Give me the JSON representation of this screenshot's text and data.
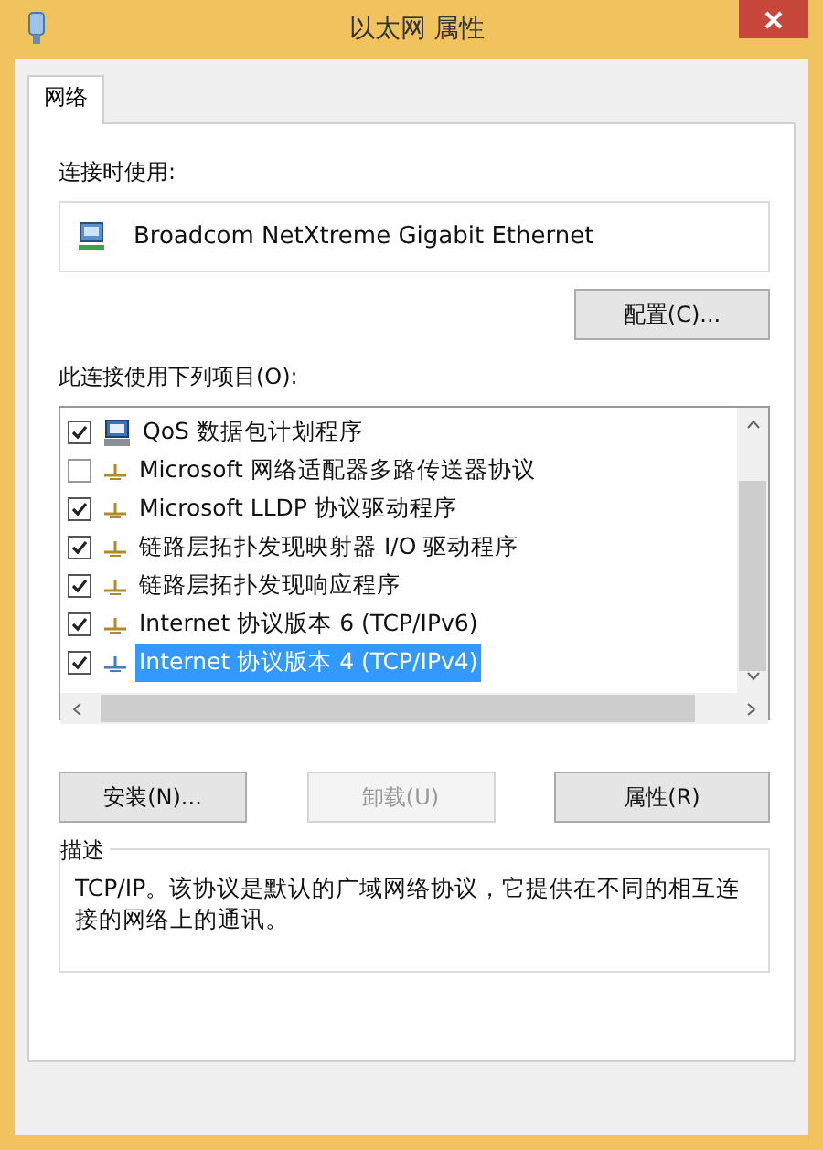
{
  "window": {
    "title": "以太网 属性"
  },
  "tabs": [
    {
      "label": "网络",
      "selected": true
    }
  ],
  "connect_using": {
    "label": "连接时使用:",
    "adapter": "Broadcom NetXtreme Gigabit Ethernet",
    "configure_button": "配置(C)..."
  },
  "items_label": "此连接使用下列项目(O):",
  "items": [
    {
      "kind": "service",
      "label": "QoS 数据包计划程序",
      "checked": true,
      "selected": false
    },
    {
      "kind": "protocol",
      "label": "Microsoft 网络适配器多路传送器协议",
      "checked": false,
      "selected": false
    },
    {
      "kind": "protocol",
      "label": "Microsoft LLDP 协议驱动程序",
      "checked": true,
      "selected": false
    },
    {
      "kind": "protocol",
      "label": "链路层拓扑发现映射器 I/O 驱动程序",
      "checked": true,
      "selected": false
    },
    {
      "kind": "protocol",
      "label": "链路层拓扑发现响应程序",
      "checked": true,
      "selected": false
    },
    {
      "kind": "protocol",
      "label": "Internet 协议版本 6 (TCP/IPv6)",
      "checked": true,
      "selected": false
    },
    {
      "kind": "protocol",
      "label": "Internet 协议版本 4 (TCP/IPv4)",
      "checked": true,
      "selected": true
    }
  ],
  "buttons": [
    {
      "label": "安装(N)...",
      "disabled": false
    },
    {
      "label": "卸载(U)",
      "disabled": true
    },
    {
      "label": "属性(R)",
      "disabled": false
    }
  ],
  "description": {
    "title": "描述",
    "text": "TCP/IP。该协议是默认的广域网络协议，它提供在不同的相互连接的网络上的通讯。"
  }
}
